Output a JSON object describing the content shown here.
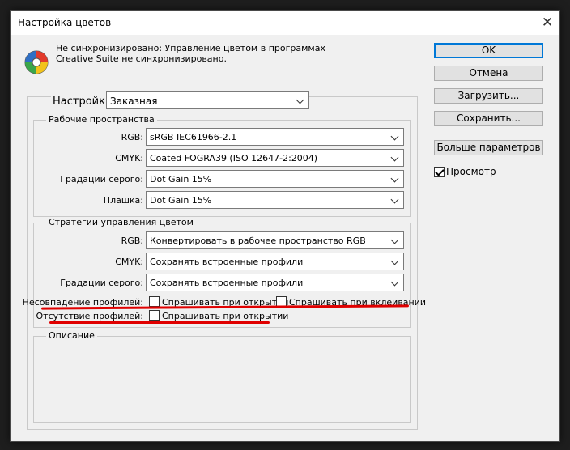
{
  "window": {
    "title": "Настройка цветов",
    "close": "✕"
  },
  "sync": {
    "icon": "color-wheel-icon",
    "line1": "Не синхронизировано: Управление цветом в программах",
    "line2": "Creative Suite не синхронизировано."
  },
  "buttons": {
    "ok": "OK",
    "cancel": "Отмена",
    "load": "Загрузить...",
    "save": "Сохранить...",
    "more": "Больше параметров"
  },
  "preview": {
    "label": "Просмотр",
    "checked": true
  },
  "settings": {
    "label": "Настройки:",
    "value": "Заказная"
  },
  "working_spaces": {
    "title": "Рабочие пространства",
    "rows": [
      {
        "label": "RGB:",
        "value": "sRGB IEC61966-2.1"
      },
      {
        "label": "CMYK:",
        "value": "Coated FOGRA39 (ISO 12647-2:2004)"
      },
      {
        "label": "Градации серого:",
        "value": "Dot Gain 15%"
      },
      {
        "label": "Плашка:",
        "value": "Dot Gain 15%"
      }
    ]
  },
  "policies": {
    "title": "Стратегии управления цветом",
    "rows": [
      {
        "label": "RGB:",
        "value": "Конвертировать в рабочее пространство RGB"
      },
      {
        "label": "CMYK:",
        "value": "Сохранять встроенные профили"
      },
      {
        "label": "Градации серого:",
        "value": "Сохранять встроенные профили"
      }
    ],
    "mismatch_label": "Несовпадение профилей:",
    "mismatch_open": "Спрашивать при открытии",
    "mismatch_paste": "Спрашивать при вклеивании",
    "missing_label": "Отсутствие профилей:",
    "missing_open": "Спрашивать при открытии"
  },
  "description": {
    "title": "Описание"
  },
  "colors": {
    "accent": "#0078d7",
    "annotation": "#e00000"
  }
}
